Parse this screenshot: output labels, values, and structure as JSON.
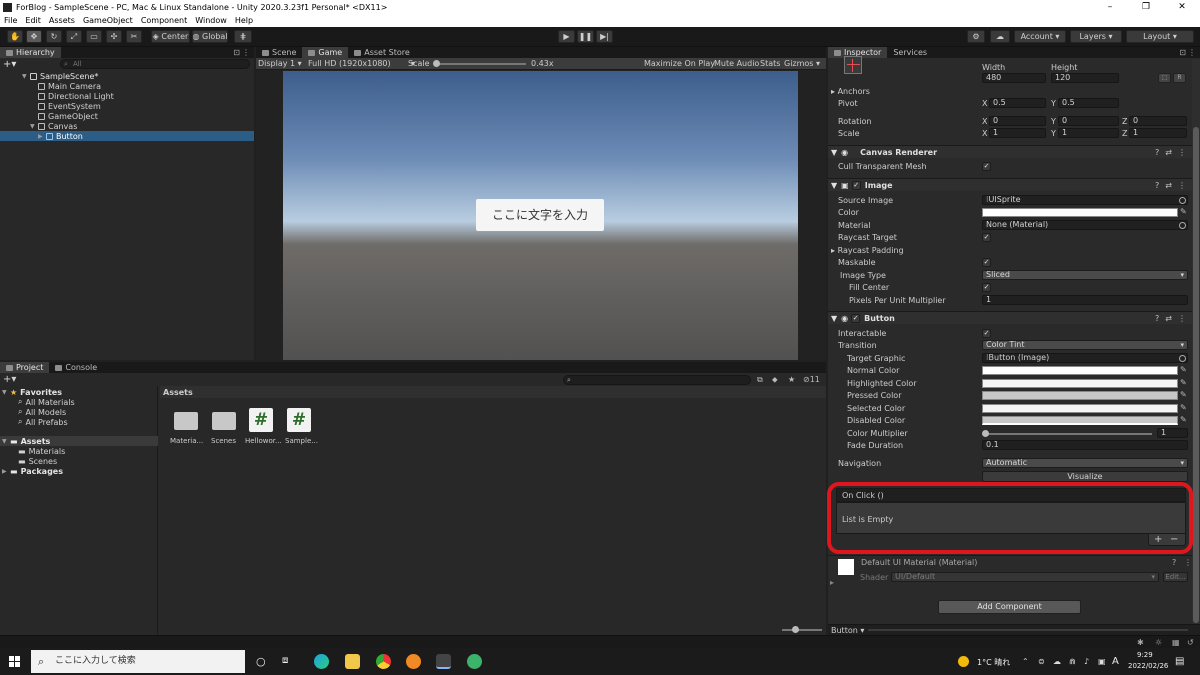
{
  "window": {
    "title": "ForBlog - SampleScene - PC, Mac & Linux Standalone - Unity 2020.3.23f1 Personal* <DX11>",
    "minimize": "–",
    "maximize": "❐",
    "close": "✕"
  },
  "menu": [
    "File",
    "Edit",
    "Assets",
    "GameObject",
    "Component",
    "Window",
    "Help"
  ],
  "toolbar": {
    "center": "Center",
    "global": "Global",
    "account": "Account",
    "layers": "Layers",
    "layout": "Layout"
  },
  "hierarchy": {
    "tab": "Hierarchy",
    "search_placeholder": "All",
    "items": [
      {
        "label": "SampleScene*"
      },
      {
        "label": "Main Camera"
      },
      {
        "label": "Directional Light"
      },
      {
        "label": "EventSystem"
      },
      {
        "label": "GameObject"
      },
      {
        "label": "Canvas"
      },
      {
        "label": "Button"
      }
    ]
  },
  "scene_tabs": {
    "scene": "Scene",
    "game": "Game",
    "asset_store": "Asset Store"
  },
  "game_toolbar": {
    "display": "Display 1",
    "resolution": "Full HD (1920x1080)",
    "scale_label": "Scale",
    "scale_value": "0.43x",
    "maximize": "Maximize On Play",
    "mute": "Mute Audio",
    "stats": "Stats",
    "gizmos": "Gizmos"
  },
  "game_view": {
    "button_text": "ここに文字を入力"
  },
  "project": {
    "tab_project": "Project",
    "tab_console": "Console",
    "favorites": "Favorites",
    "fav_items": [
      "All Materials",
      "All Models",
      "All Prefabs"
    ],
    "assets": "Assets",
    "asset_folders": [
      "Materials",
      "Scenes"
    ],
    "packages": "Packages",
    "breadcrumb": "Assets",
    "hidden_count": "11",
    "files": [
      {
        "name": "Materia...",
        "icon": "folder-icon"
      },
      {
        "name": "Scenes",
        "icon": "folder-icon"
      },
      {
        "name": "Hellowor...",
        "icon": "csharp-script-icon"
      },
      {
        "name": "Sample...",
        "icon": "csharp-script-icon"
      }
    ]
  },
  "inspector": {
    "tab": "Inspector",
    "tab_services": "Services",
    "rect": {
      "width_label": "Width",
      "height_label": "Height",
      "width": "480",
      "height": "120",
      "anchors": "Anchors",
      "pivot": "Pivot",
      "pivot_x": "0.5",
      "pivot_y": "0.5",
      "rotation": "Rotation",
      "rot_x": "0",
      "rot_y": "0",
      "rot_z": "0",
      "scale": "Scale",
      "scale_x": "1",
      "scale_y": "1",
      "scale_z": "1",
      "axis_x": "X",
      "axis_y": "Y",
      "axis_z": "Z",
      "r_button": "R"
    },
    "canvas_renderer": {
      "title": "Canvas Renderer",
      "cull": "Cull Transparent Mesh"
    },
    "image": {
      "title": "Image",
      "source_image": "Source Image",
      "source_value": "UISprite",
      "color": "Color",
      "material": "Material",
      "material_value": "None (Material)",
      "raycast_target": "Raycast Target",
      "raycast_padding": "Raycast Padding",
      "maskable": "Maskable",
      "image_type": "Image Type",
      "image_type_value": "Sliced",
      "fill_center": "Fill Center",
      "ppu": "Pixels Per Unit Multiplier",
      "ppu_value": "1"
    },
    "button": {
      "title": "Button",
      "interactable": "Interactable",
      "transition": "Transition",
      "transition_value": "Color Tint",
      "target_graphic": "Target Graphic",
      "target_graphic_value": "Button (Image)",
      "normal": "Normal Color",
      "highlighted": "Highlighted Color",
      "pressed": "Pressed Color",
      "selected": "Selected Color",
      "disabled": "Disabled Color",
      "multiplier": "Color Multiplier",
      "multiplier_value": "1",
      "fade": "Fade Duration",
      "fade_value": "0.1",
      "navigation": "Navigation",
      "navigation_value": "Automatic",
      "visualize": "Visualize"
    },
    "onclick": {
      "title": "On Click ()",
      "empty": "List is Empty",
      "add": "+",
      "remove": "−"
    },
    "material": {
      "title": "Default UI Material (Material)",
      "shader_label": "Shader",
      "shader_value": "UI/Default",
      "edit": "Edit..."
    },
    "add_component": "Add Component",
    "footer": "Button"
  },
  "taskbar": {
    "search_placeholder": "ここに入力して検索",
    "weather": "1°C 晴れ",
    "ime": "A",
    "time": "9:29",
    "date": "2022/02/26"
  },
  "colors": {
    "highlight_red": "#e0161e",
    "selection": "#2c5d87",
    "accent_blue": "#3a72b0"
  }
}
